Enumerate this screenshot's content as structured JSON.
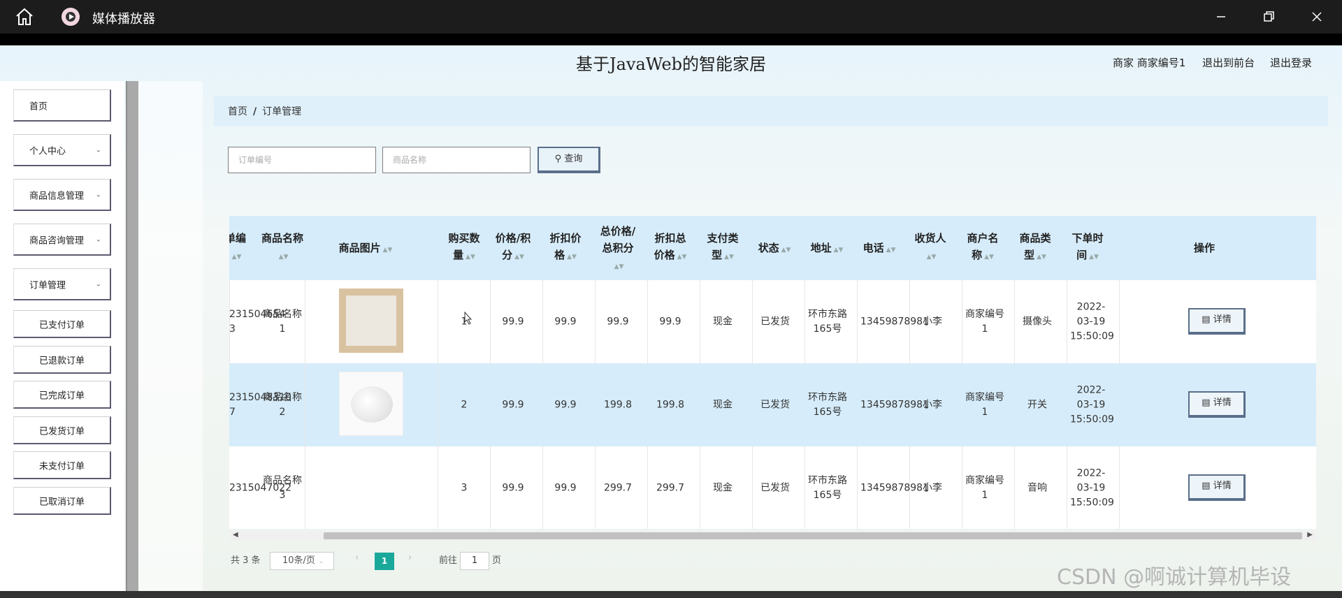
{
  "window": {
    "app_title": "媒体播放器"
  },
  "header": {
    "site_title": "基于JavaWeb的智能家居",
    "user": "商家 商家编号1",
    "to_front": "退出到前台",
    "logout": "退出登录"
  },
  "sidebar": {
    "items": [
      {
        "label": "首页",
        "chevron": false
      },
      {
        "label": "个人中心",
        "chevron": true
      },
      {
        "label": "商品信息管理",
        "chevron": true
      },
      {
        "label": "商品咨询管理",
        "chevron": true
      },
      {
        "label": "订单管理",
        "chevron": true
      }
    ],
    "sub_items": [
      "已支付订单",
      "已退款订单",
      "已完成订单",
      "已发货订单",
      "未支付订单",
      "已取消订单"
    ]
  },
  "breadcrumb": {
    "home": "首页",
    "sep": "/",
    "current": "订单管理"
  },
  "search": {
    "order_placeholder": "订单编号",
    "goods_placeholder": "商品名称",
    "button": "查询"
  },
  "table": {
    "headers": {
      "order_no": "单编",
      "goods_name": "商品名称",
      "goods_image": "商品图片",
      "qty": "购买数量",
      "price": "价格/积分",
      "discount_price": "折扣价格",
      "total": "总价格/总积分",
      "discount_total": "折扣总价格",
      "pay_type": "支付类型",
      "status": "状态",
      "address": "地址",
      "phone": "电话",
      "receiver": "收货人",
      "merchant": "商户名称",
      "category": "商品类型",
      "order_time": "下单时间",
      "action": "操作"
    },
    "rows": [
      {
        "order_no": "231504654 3",
        "goods_name": "商品名称1",
        "qty": "1",
        "price": "99.9",
        "discount_price": "99.9",
        "total": "99.9",
        "discount_total": "99.9",
        "pay_type": "现金",
        "status": "已发货",
        "address": "环市东路165号",
        "phone": "13459878981",
        "receiver": "小李",
        "merchant": "商家编号1",
        "category": "摄像头",
        "order_time": "2022-03-19 15:50:09",
        "action": "详情"
      },
      {
        "order_no": "2315048310 7",
        "goods_name": "商品名称2",
        "qty": "2",
        "price": "99.9",
        "discount_price": "99.9",
        "total": "199.8",
        "discount_total": "199.8",
        "pay_type": "现金",
        "status": "已发货",
        "address": "环市东路165号",
        "phone": "13459878981",
        "receiver": "小李",
        "merchant": "商家编号1",
        "category": "开关",
        "order_time": "2022-03-19 15:50:09",
        "action": "详情"
      },
      {
        "order_no": "2315047022",
        "goods_name": "商品名称3",
        "qty": "3",
        "price": "99.9",
        "discount_price": "99.9",
        "total": "299.7",
        "discount_total": "299.7",
        "pay_type": "现金",
        "status": "已发货",
        "address": "环市东路165号",
        "phone": "13459878981",
        "receiver": "小李",
        "merchant": "商家编号1",
        "category": "音响",
        "order_time": "2022-03-19 15:50:09",
        "action": "详情"
      }
    ]
  },
  "pagination": {
    "total": "共 3 条",
    "page_size": "10条/页",
    "current_page": "1",
    "goto_label": "前往",
    "goto_value": "1",
    "page_label": "页"
  },
  "watermark": "CSDN @啊诚计算机毕设"
}
